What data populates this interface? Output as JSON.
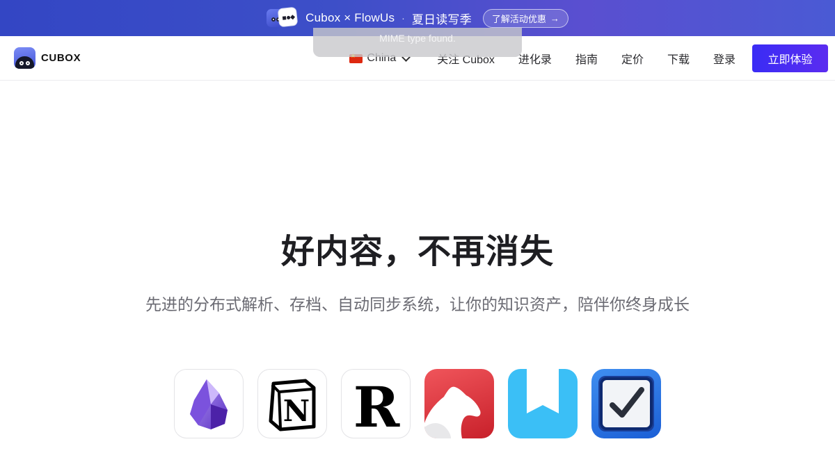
{
  "promo": {
    "title": "Cubox × FlowUs",
    "dot": "·",
    "subtitle": "夏日读写季",
    "cta_label": "了解活动优惠",
    "cta_arrow": "→"
  },
  "toast": {
    "text": "MIME type found."
  },
  "brand": {
    "name": "CUBOX"
  },
  "nav": {
    "language": "China",
    "links": [
      "关注 Cubox",
      "进化录",
      "指南",
      "定价",
      "下载",
      "登录"
    ],
    "cta": "立即体验"
  },
  "hero": {
    "title": "好内容，不再消失",
    "subtitle": "先进的分布式解析、存档、自动同步系统，让你的知识资产，陪伴你终身成长"
  },
  "integrations": [
    {
      "icon": "obsidian-icon"
    },
    {
      "icon": "notion-icon"
    },
    {
      "icon": "readwise-icon"
    },
    {
      "icon": "bear-icon"
    },
    {
      "icon": "day-one-icon"
    },
    {
      "icon": "things-icon"
    }
  ],
  "colors": {
    "accent": "#3a2cf5",
    "banner": "#3d4fc8"
  }
}
